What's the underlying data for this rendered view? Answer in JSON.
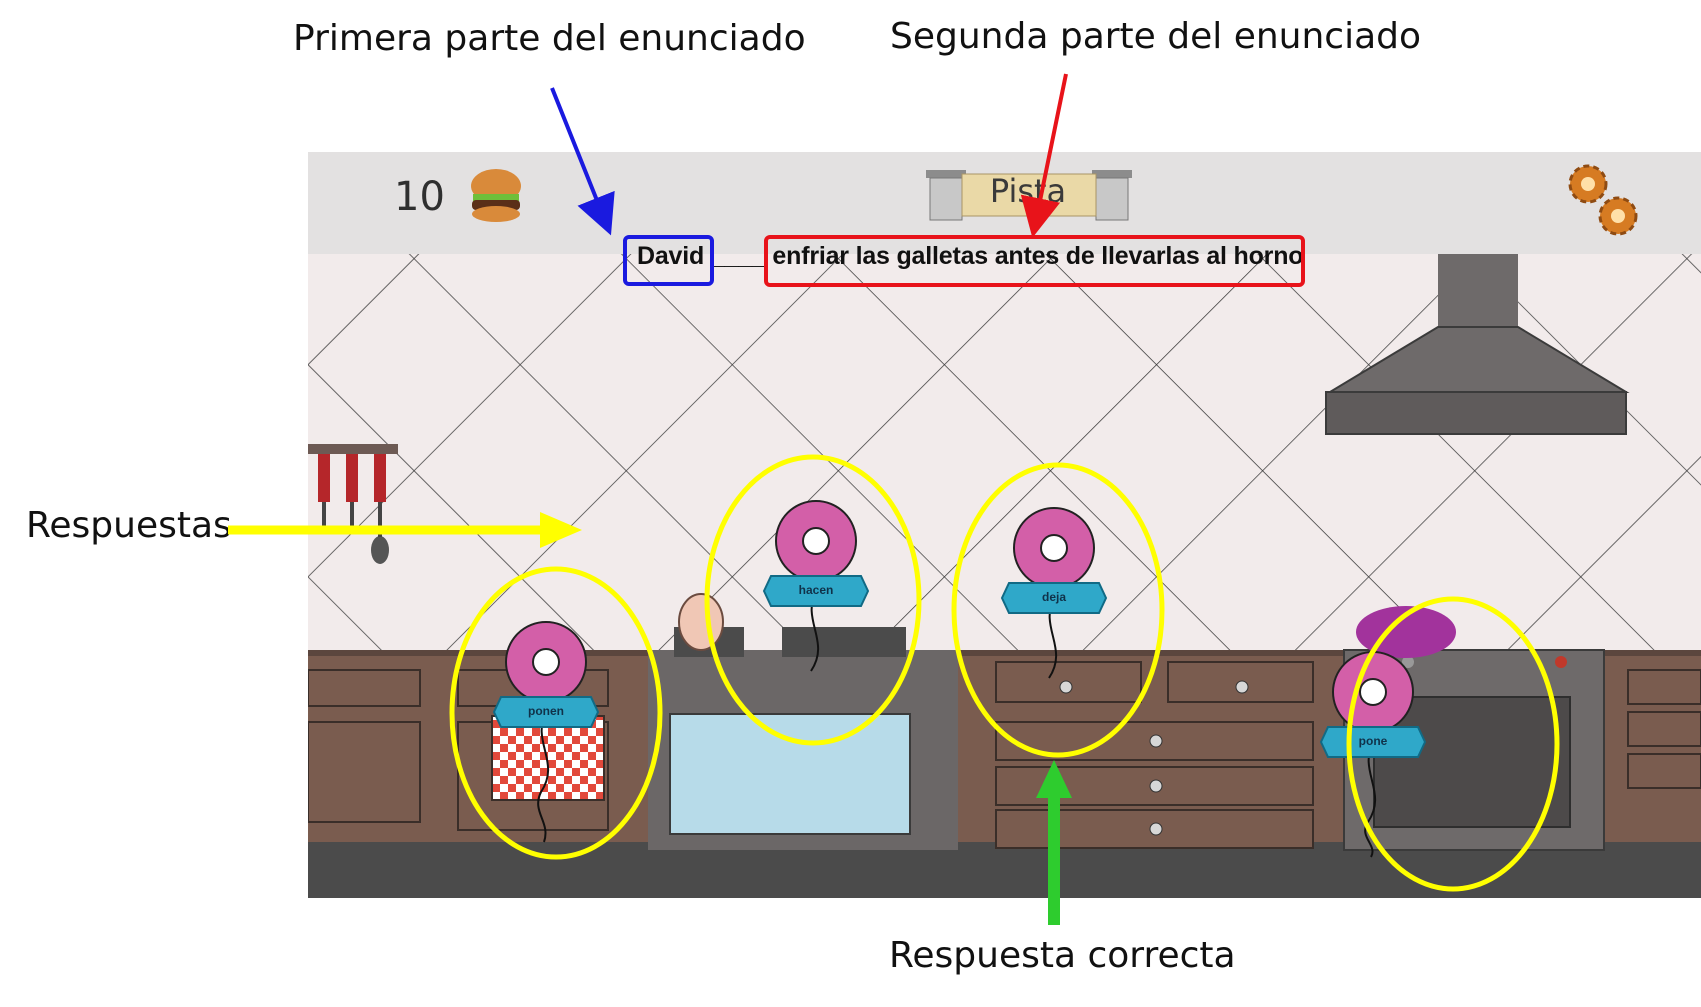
{
  "annotations": {
    "first_part": "Primera parte del enunciado",
    "second_part": "Segunda parte del enunciado",
    "answers": "Respuestas",
    "correct_answer": "Respuesta correcta"
  },
  "game": {
    "score": "10",
    "score_icon": "burger-icon",
    "hint_label": "Pista",
    "settings_icon": "gears-icon",
    "sentence": {
      "subject": "David",
      "blank": "____",
      "rest": "enfriar las galletas antes de llevarlas al horno"
    },
    "answers": [
      {
        "label": "ponen",
        "correct": false
      },
      {
        "label": "hacen",
        "correct": false
      },
      {
        "label": "deja",
        "correct": true
      },
      {
        "label": "pone",
        "correct": false
      }
    ]
  },
  "colors": {
    "first_part_box": "#1a1adf",
    "second_part_box": "#e8131a",
    "answers_highlight": "#ffff00",
    "correct_arrow": "#2ecc2e"
  }
}
